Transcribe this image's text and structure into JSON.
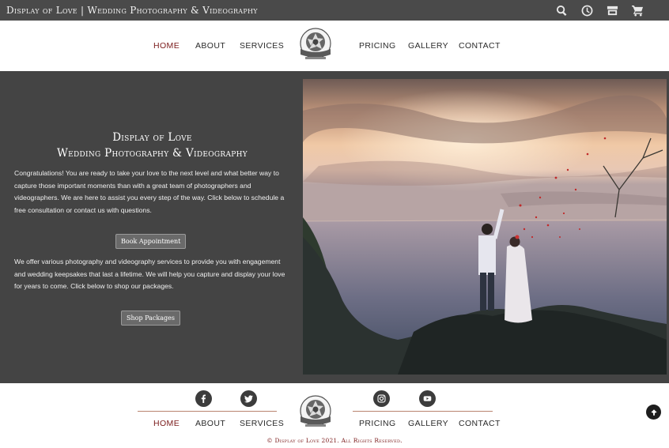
{
  "header": {
    "site_title": "Display of Love | Wedding Photography & Videography",
    "icons": [
      "search-icon",
      "clock-icon",
      "store-icon",
      "cart-icon"
    ]
  },
  "nav": {
    "items": [
      {
        "label": "HOME",
        "active": true
      },
      {
        "label": "ABOUT"
      },
      {
        "label": "SERVICES"
      },
      {
        "label": "PRICING"
      },
      {
        "label": "GALLERY"
      },
      {
        "label": "CONTACT"
      }
    ],
    "logo_icon": "camera-aperture-logo"
  },
  "hero": {
    "title_line1": "Display of Love",
    "title_line2": "Wedding Photography & Videography",
    "paragraph1": "Congratulations! You are ready to take your love to the next level and what better way to capture those important moments than with a great team of photographers and videographers. We are here to assist you every step of the way. Click below to schedule a free consultation or contact us with questions.",
    "book_button": "Book Appointment",
    "paragraph2": "We offer various photography and videography services to provide you with engagement and wedding keepsakes that last a lifetime. We will help you capture and display your love for years to come. Click below to shop our packages.",
    "shop_button": "Shop Packages",
    "photo_description_icon": "couple-on-cliff-at-sunset-photo"
  },
  "footer": {
    "social_icons": [
      "facebook-icon",
      "twitter-icon",
      "instagram-icon",
      "youtube-icon"
    ],
    "nav": [
      {
        "label": "HOME",
        "active": true
      },
      {
        "label": "ABOUT"
      },
      {
        "label": "SERVICES"
      },
      {
        "label": "PRICING"
      },
      {
        "label": "GALLERY"
      },
      {
        "label": "CONTACT"
      }
    ],
    "copyright": "© Display of Love 2021. All Rights Reserved.",
    "scroll_top_icon": "arrow-up-circle-icon"
  },
  "colors": {
    "topbar": "#4a4a4a",
    "hero_bg": "#444444",
    "accent": "#7a1a1a",
    "footer_line": "#b9846f"
  }
}
